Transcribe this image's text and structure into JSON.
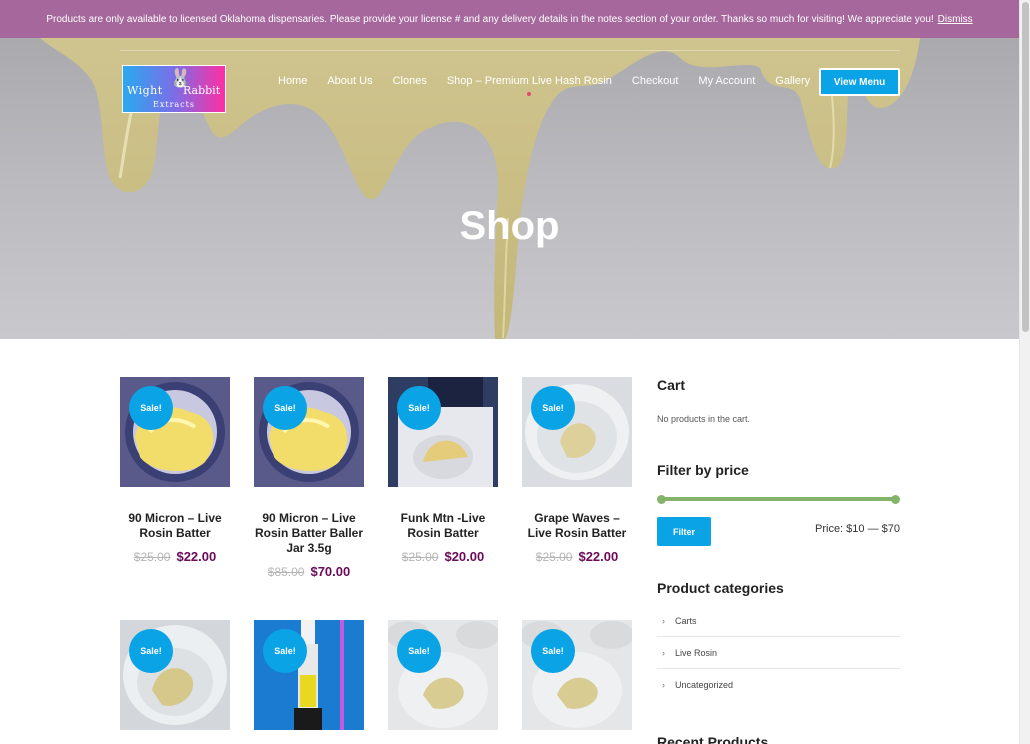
{
  "notice": {
    "text": "Products are only available to licensed Oklahoma dispensaries. Please provide your license # and any delivery details in the notes section of your order. Thanks so much for visiting! We appreciate you!",
    "dismiss": "Dismiss"
  },
  "logo": {
    "word1": "Wight",
    "word2": "Rabbit",
    "word3": "Extracts"
  },
  "nav": {
    "items": [
      "Home",
      "About Us",
      "Clones",
      "Shop – Premium Live Hash Rosin",
      "Checkout",
      "My Account",
      "Gallery"
    ],
    "active": "Shop – Premium Live Hash Rosin",
    "view_menu": "View Menu"
  },
  "hero": {
    "title": "Shop"
  },
  "products": [
    {
      "badge": "Sale!",
      "title": "90 Micron – Live Rosin Batter",
      "old_price": "$25.00",
      "price": "$22.00"
    },
    {
      "badge": "Sale!",
      "title": "90 Micron – Live Rosin Batter Baller Jar 3.5g",
      "old_price": "$85.00",
      "price": "$70.00"
    },
    {
      "badge": "Sale!",
      "title": "Funk Mtn -Live Rosin Batter",
      "old_price": "$25.00",
      "price": "$20.00"
    },
    {
      "badge": "Sale!",
      "title": "Grape Waves – Live Rosin Batter",
      "old_price": "$25.00",
      "price": "$22.00"
    },
    {
      "badge": "Sale!",
      "title": "",
      "old_price": "",
      "price": ""
    },
    {
      "badge": "Sale!",
      "title": "",
      "old_price": "",
      "price": ""
    },
    {
      "badge": "Sale!",
      "title": "",
      "old_price": "",
      "price": ""
    },
    {
      "badge": "Sale!",
      "title": "",
      "old_price": "",
      "price": ""
    }
  ],
  "sidebar": {
    "cart_title": "Cart",
    "cart_empty": "No products in the cart.",
    "filter_title": "Filter by price",
    "filter_button": "Filter",
    "price_range": "Price: $10 — $70",
    "categories_title": "Product categories",
    "categories": [
      "Carts",
      "Live Rosin",
      "Uncategorized"
    ],
    "recent_title": "Recent Products"
  },
  "colors": {
    "notice_bg": "#a5679c",
    "accent": "#0aa3e6",
    "price": "#6a0b5a",
    "slider": "#84b36a"
  }
}
